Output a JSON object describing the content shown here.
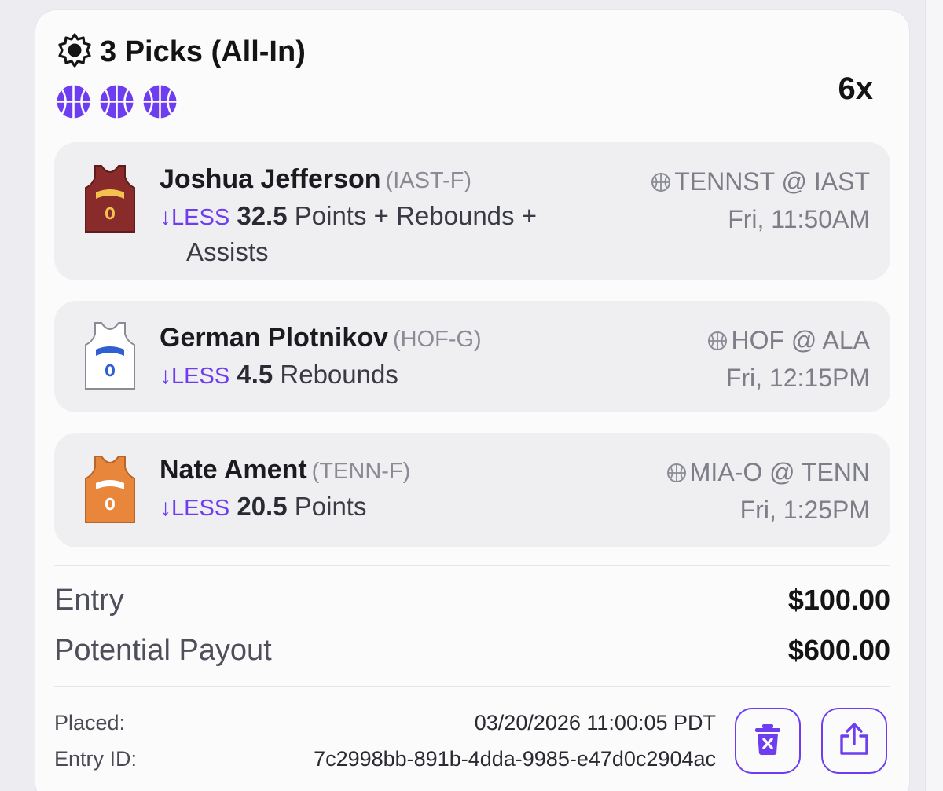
{
  "header": {
    "title": "3 Picks (All-In)",
    "multiplier": "6x",
    "sport_badges": [
      "basketball-icon",
      "basketball-icon",
      "basketball-icon"
    ],
    "accent_color": "#6f3df0"
  },
  "picks": [
    {
      "player": "Joshua Jefferson",
      "team_pos": "(IAST-F)",
      "direction": "LESS",
      "line": "32.5",
      "stat": "Points + Rebounds +",
      "stat_cont": "Assists",
      "game": "TENNST @ IAST",
      "time": "Fri, 11:50AM",
      "jersey_number": "0",
      "jersey_color": "#8a2b2b",
      "jersey_accent": "#f2c14e"
    },
    {
      "player": "German Plotnikov",
      "team_pos": "(HOF-G)",
      "direction": "LESS",
      "line": "4.5",
      "stat": "Rebounds",
      "stat_cont": "",
      "game": "HOF @ ALA",
      "time": "Fri, 12:15PM",
      "jersey_number": "0",
      "jersey_color": "#ffffff",
      "jersey_accent": "#2f5fd0"
    },
    {
      "player": "Nate Ament",
      "team_pos": "(TENN-F)",
      "direction": "LESS",
      "line": "20.5",
      "stat": "Points",
      "stat_cont": "",
      "game": "MIA-O @ TENN",
      "time": "Fri, 1:25PM",
      "jersey_number": "0",
      "jersey_color": "#e8873c",
      "jersey_accent": "#ffffff"
    }
  ],
  "summary": {
    "entry_label": "Entry",
    "entry_value": "$100.00",
    "payout_label": "Potential Payout",
    "payout_value": "$600.00"
  },
  "meta": {
    "placed_label": "Placed:",
    "placed_value": "03/20/2026 11:00:05 PDT",
    "entry_id_label": "Entry ID:",
    "entry_id_value": "7c2998bb-891b-4dda-9985-e47d0c2904ac"
  },
  "actions": {
    "delete_icon": "trash-x-icon",
    "share_icon": "share-icon"
  }
}
